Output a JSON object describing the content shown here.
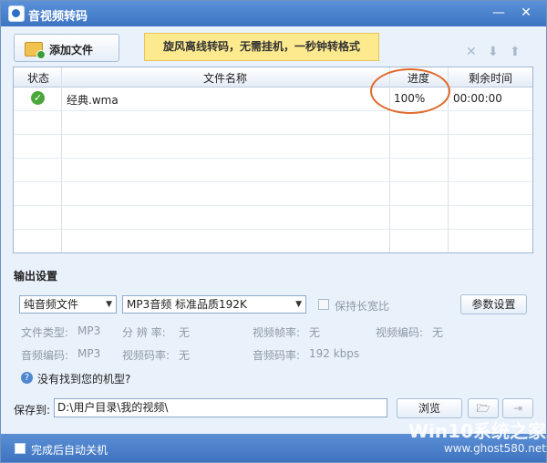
{
  "window": {
    "title": "音视频转码"
  },
  "toolbar": {
    "add_file_label": "添加文件",
    "banner_text": "旋风离线转码，无需挂机，一秒钟转格式",
    "delete_icon": "close-icon",
    "move_down_icon": "arrow-down-icon",
    "move_up_icon": "arrow-up-icon"
  },
  "table": {
    "headers": {
      "status": "状态",
      "name": "文件名称",
      "progress": "进度",
      "remaining": "剩余时间"
    },
    "rows": [
      {
        "status": "complete",
        "name": "经典.wma",
        "progress": "100%",
        "remaining": "00:00:00"
      }
    ]
  },
  "output": {
    "section_title": "输出设置",
    "format_select": "纯音频文件",
    "quality_select": "MP3音频 标准品质192K",
    "keep_ratio_label": "保持长宽比",
    "params_button": "参数设置",
    "file_type_label": "文件类型:",
    "file_type_value": "MP3",
    "resolution_label": "分 辨 率:",
    "resolution_value": "无",
    "video_fps_label": "视频帧率:",
    "video_fps_value": "无",
    "video_codec_label": "视频编码:",
    "video_codec_value": "无",
    "audio_codec_label": "音频编码:",
    "audio_codec_value": "MP3",
    "video_bitrate_label": "视频码率:",
    "video_bitrate_value": "无",
    "audio_bitrate_label": "音频码率:",
    "audio_bitrate_value": "192 kbps",
    "help_text": "没有找到您的机型?"
  },
  "save": {
    "label": "保存到:",
    "path": "D:\\用户目录\\我的视频\\",
    "browse_button": "浏览"
  },
  "footer": {
    "auto_shutdown_label": "完成后自动关机"
  },
  "watermark": {
    "line1": "Win10系统之家",
    "line2": "www.ghost580.net"
  }
}
